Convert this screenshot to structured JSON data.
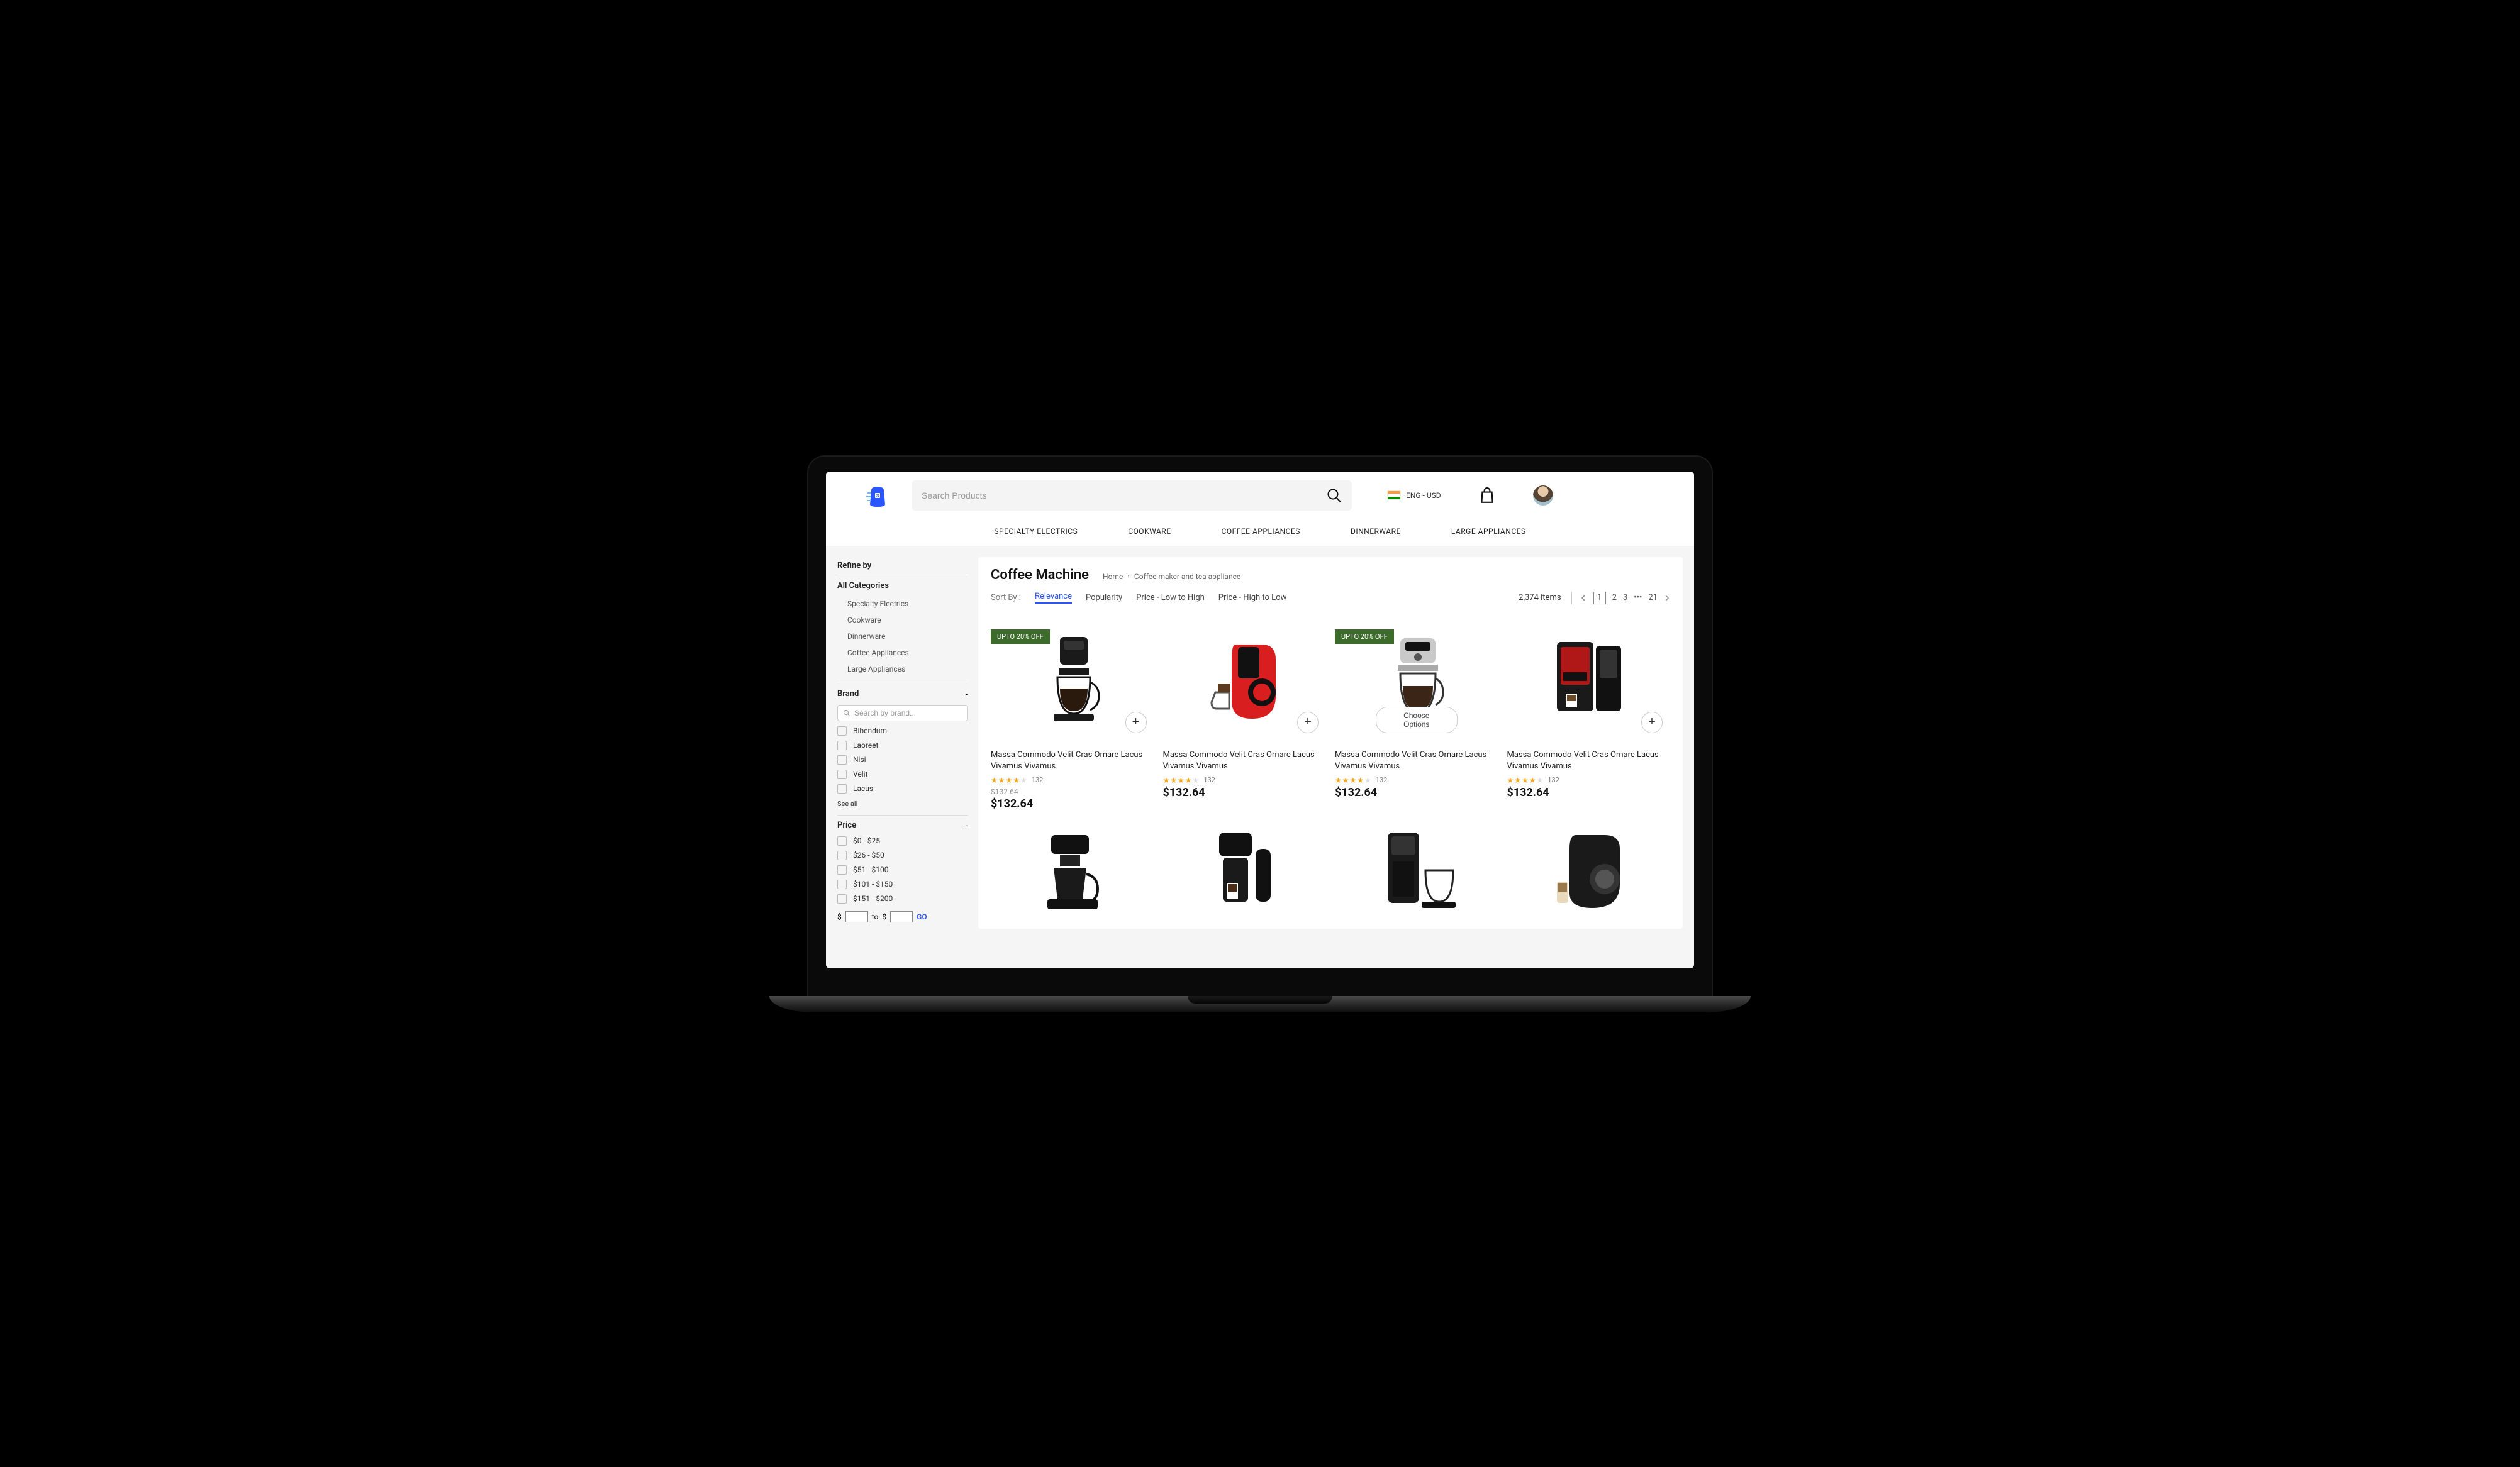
{
  "header": {
    "search_placeholder": "Search Products",
    "locale": "ENG - USD",
    "nav": [
      "SPECIALTY ELECTRICS",
      "COOKWARE",
      "COFFEE APPLIANCES",
      "DINNERWARE",
      "LARGE APPLIANCES"
    ]
  },
  "sidebar": {
    "refine": "Refine by",
    "all_cat": "All Categories",
    "cats": [
      "Specialty Electrics",
      "Cookware",
      "Dinnerware",
      "Coffee Appliances",
      "Large Appliances"
    ],
    "brand_label": "Brand",
    "brand_search_ph": "Search by brand...",
    "brands": [
      "Bibendum",
      "Laoreet",
      "Nisi",
      "Velit",
      "Lacus"
    ],
    "see_all": "See all",
    "price_label": "Price",
    "prices": [
      "$0 - $25",
      "$26 - $50",
      "$51 - $100",
      "$101 - $150",
      "$151 - $200"
    ],
    "to": "to",
    "go": "GO",
    "dollar": "$"
  },
  "main": {
    "title": "Coffee Machine",
    "crumb_home": "Home",
    "crumb_page": "Coffee maker and tea appliance",
    "sort_label": "Sort By  :",
    "sort_opts": [
      "Relevance",
      "Popularity",
      "Price - Low to High",
      "Price - High to Low"
    ],
    "count": "2,374 items",
    "pages": [
      "1",
      "2",
      "3"
    ],
    "ellipsis": "•••",
    "last_page": "21",
    "badge": "UPTO 20% OFF",
    "choose": "Choose Options",
    "product_name": "Massa Commodo Velit Cras Ornare Lacus Vivamus Vivamus",
    "reviews": "132",
    "old_price": "$132.64",
    "price": "$132.64",
    "plus": "+"
  }
}
